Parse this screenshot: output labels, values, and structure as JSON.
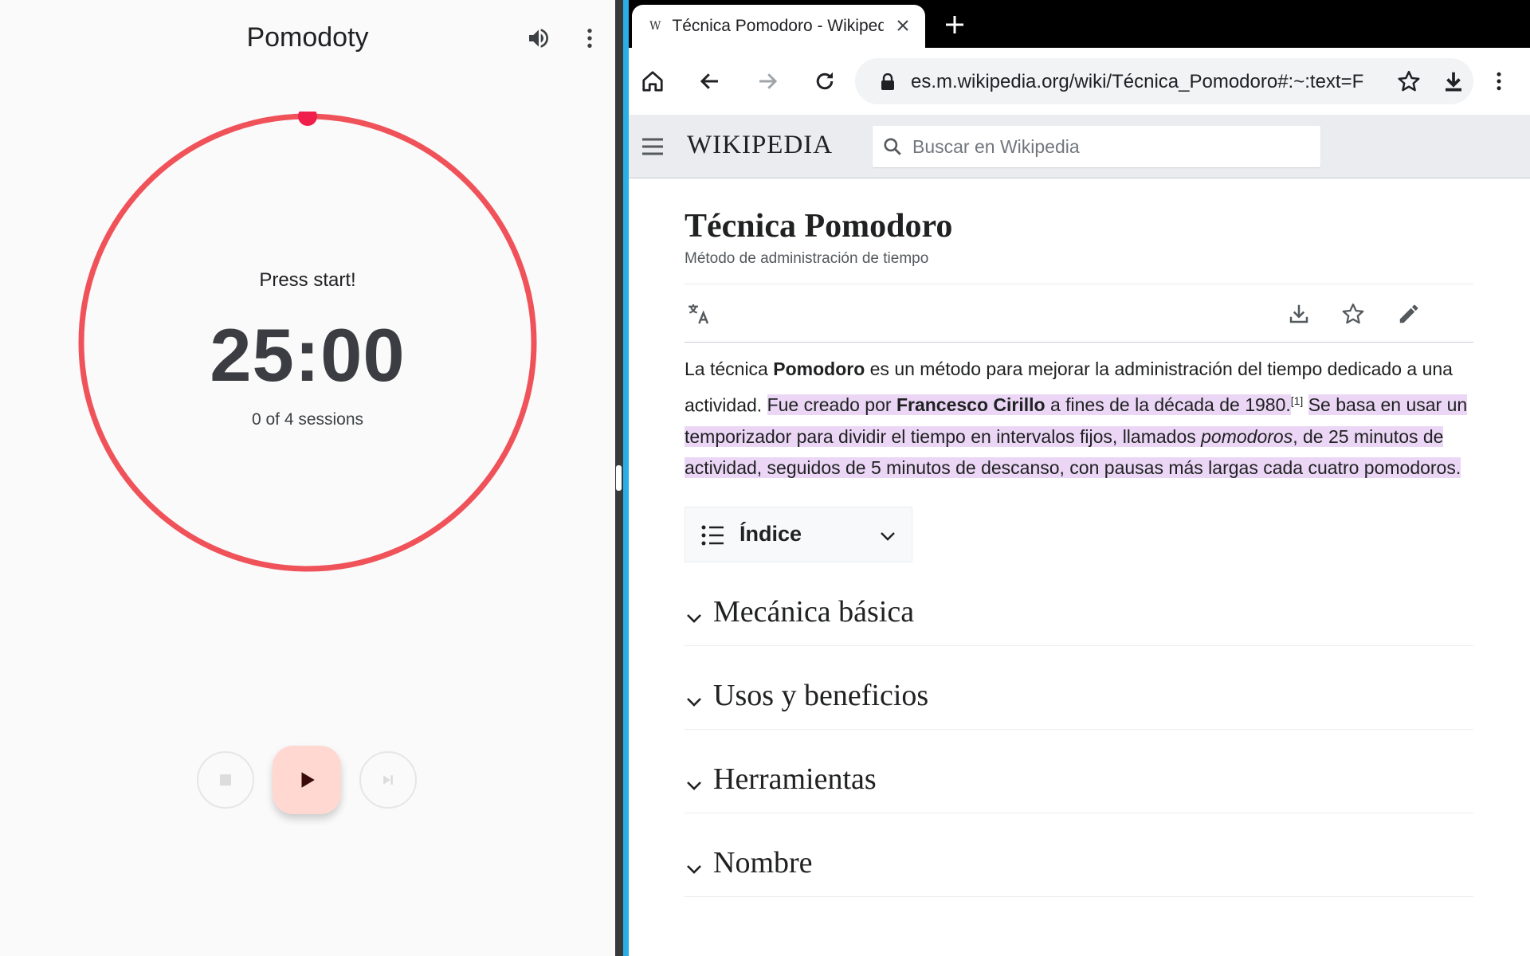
{
  "pomodoro_app": {
    "title": "Pomodoty",
    "status": "Press start!",
    "time": "25:00",
    "sessions": "0 of 4 sessions",
    "progress": 0,
    "accent_color": "#f0525a",
    "icons": {
      "volume": "volume-icon",
      "menu": "more-vert-icon",
      "stop": "stop-icon",
      "play": "play-icon",
      "skip": "skip-next-icon"
    }
  },
  "browser": {
    "tab": {
      "title": "Técnica Pomodoro - Wikipedia",
      "favicon": "W"
    },
    "url": "es.m.wikipedia.org/wiki/Técnica_Pomodoro#:~:text=F",
    "icons": {
      "home": "home-icon",
      "back": "back-icon",
      "forward": "forward-icon",
      "reload": "reload-icon",
      "lock": "lock-icon",
      "star": "star-icon",
      "download": "download-icon",
      "menu": "more-vert-icon",
      "close": "close-icon",
      "new_tab": "plus-icon"
    }
  },
  "wikipedia": {
    "logo": "WIKIPEDIA",
    "search_placeholder": "Buscar en Wikipedia",
    "article": {
      "title": "Técnica Pomodoro",
      "description": "Método de administración de tiempo",
      "lead": {
        "p1_a": "La técnica ",
        "p1_b": "Pomodoro",
        "p1_c": " es un método para mejorar la administración del tiempo dedicado a una actividad. ",
        "h1": "Fue creado por ",
        "h2": "Francesco Cirillo",
        "h3": " a fines de la década de 1980.",
        "ref": "[1]",
        "h4": "Se basa en usar un temporizador para dividir el tiempo en intervalos fijos, llamados ",
        "h5": "pomodoros",
        "h6": ", de 25 minutos de actividad, seguidos de 5 minutos de descanso, con pausas más largas cada cuatro pomodoros."
      },
      "toc_label": "Índice",
      "sections": [
        "Mecánica básica",
        "Usos y beneficios",
        "Herramientas",
        "Nombre"
      ]
    },
    "highlight_color": "#ebd7f5"
  }
}
